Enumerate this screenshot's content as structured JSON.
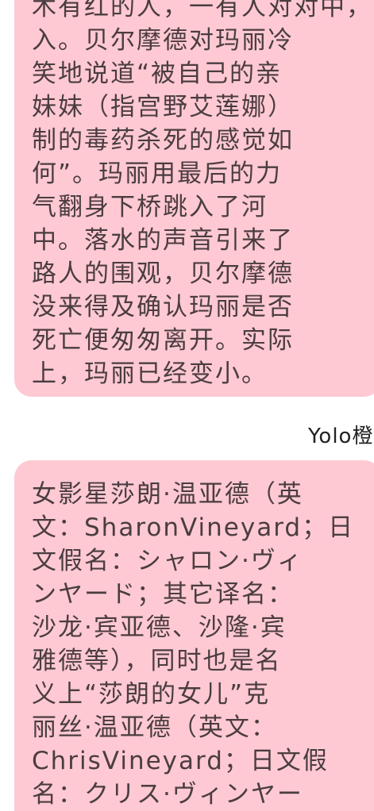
{
  "messages": [
    {
      "lines": [
        "木有红的人，一有人对对中，",
        "入。贝尔摩德对玛丽冷",
        "笑地说道“被自己的亲",
        "妹妹（指宫野艾莲娜）",
        "制的毒药杀死的感觉如",
        "何”。玛丽用最后的力",
        "气翻身下桥跳入了河",
        "中。落水的声音引来了",
        "路人的围观，贝尔摩德",
        "没来得及确认玛丽是否",
        "死亡便匆匆离开。实际",
        "上，玛丽已经变小。"
      ]
    },
    {
      "sender": "Yolo橙",
      "lines": [
        "女影星莎朗·温亚德（英",
        "文：SharonVineyard；日",
        "文假名：シャロン·ヴィ",
        "ンヤード；其它译名：",
        "沙龙·宾亚德、沙隆·宾",
        "雅德等），同时也是名",
        "义上“莎朗的女儿”克",
        "丽丝·温亚德（英文：",
        "ChrisVineyard；日文假",
        "名：クリス·ヴィンヤー"
      ]
    }
  ],
  "colors": {
    "bubble_background": "#ffc9d3",
    "bubble_text": "#4a3d40",
    "page_background": "#ffffff"
  }
}
